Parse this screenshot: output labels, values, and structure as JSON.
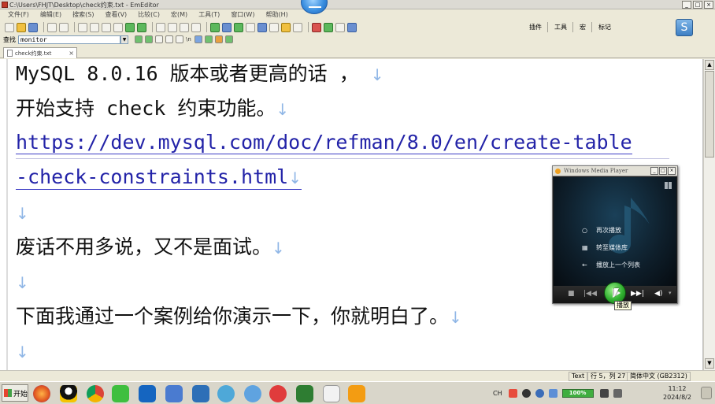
{
  "window": {
    "title": "C:\\Users\\FHJT\\Desktop\\check约束.txt - EmEditor",
    "buttons": [
      "_",
      "□",
      "×"
    ]
  },
  "menubar": {
    "items": [
      "文件(F)",
      "编辑(E)",
      "搜索(S)",
      "查看(V)",
      "比较(C)",
      "宏(M)",
      "工具(T)",
      "窗口(W)",
      "帮助(H)"
    ]
  },
  "toolbar": {
    "plugins_label": "插件",
    "tools_label": "工具",
    "macro_label": "宏",
    "bookmark_label": "标记"
  },
  "find_bar": {
    "label": "查找",
    "value": "monitor",
    "regex_label": "\\n"
  },
  "tab": {
    "label": "check约束.txt",
    "close": "×"
  },
  "editor": {
    "return_mark": "↓",
    "lines": [
      "MySQL 8.0.16 版本或者更高的话 ，",
      "开始支持 check 约束功能。",
      "https://dev.mysql.com/doc/refman/8.0/en/create-table",
      "-check-constraints.html",
      "",
      "废话不用多说，又不是面试。",
      "",
      "下面我通过一个案例给你演示一下，你就明白了。",
      ""
    ]
  },
  "status_bar": {
    "mode": "Text",
    "position": "行 5，列 27",
    "encoding": "简体中文 (GB2312)"
  },
  "media_player": {
    "title": "Windows Media Player",
    "menu": [
      {
        "icon": "○",
        "label": "再次播放"
      },
      {
        "icon": "▦",
        "label": "转至媒体库"
      },
      {
        "icon": "←",
        "label": "播放上一个列表"
      }
    ],
    "tooltip": "播放"
  },
  "taskbar": {
    "start_label": "开始",
    "tray_lang": "CH",
    "battery": "100%",
    "time": "11:12",
    "date": "2024/8/2"
  },
  "colors": {
    "link": "#2323a8",
    "return_mark": "#8fb6e6",
    "wmp_play": "#2fb02f"
  }
}
